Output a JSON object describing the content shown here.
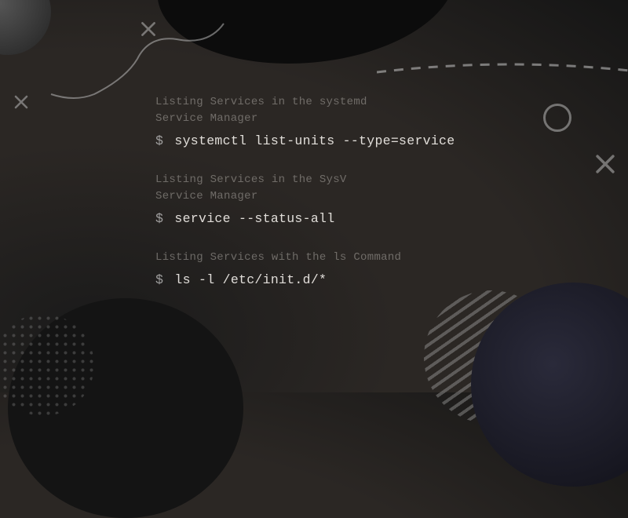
{
  "sections": [
    {
      "comment": "Listing Services in the systemd\nService Manager",
      "prompt": "$",
      "command": "systemctl list-units --type=service"
    },
    {
      "comment": "Listing Services in the SysV\nService Manager",
      "prompt": "$",
      "command": "service --status-all"
    },
    {
      "comment": "Listing Services with the ls Command",
      "prompt": "$",
      "command": "ls -l /etc/init.d/*"
    }
  ]
}
